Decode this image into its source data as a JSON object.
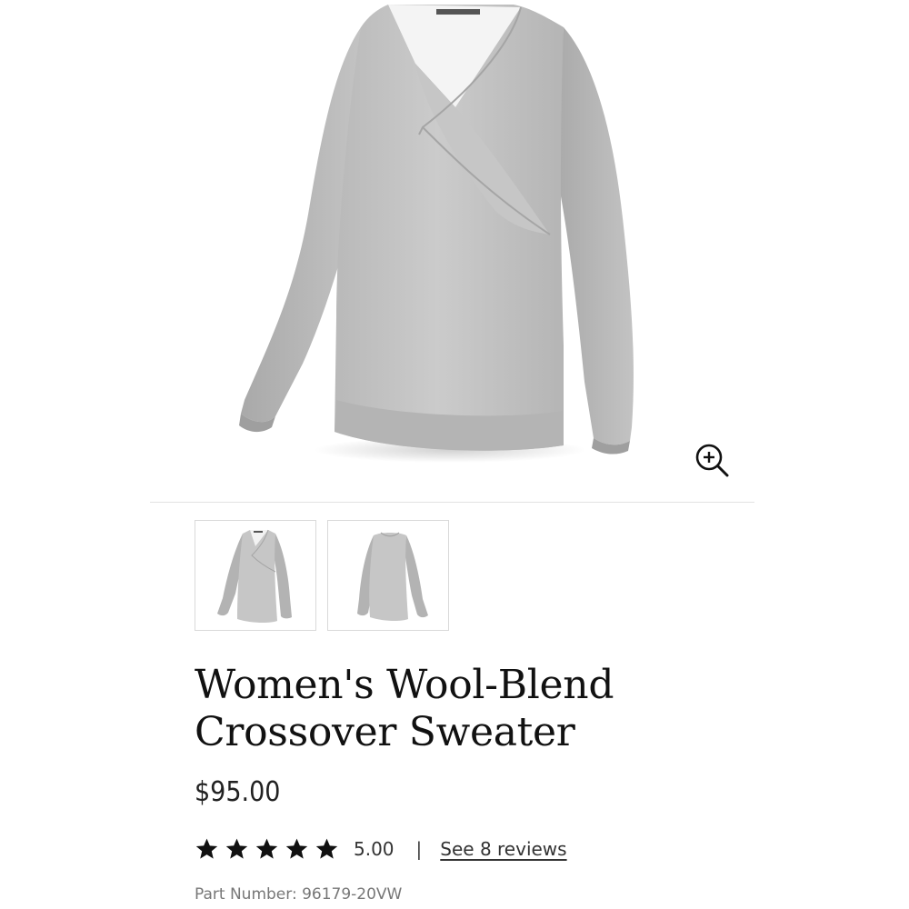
{
  "product": {
    "title_line1": "Women's Wool-Blend",
    "title_line2": "Crossover Sweater",
    "price": "$95.00",
    "rating": {
      "stars": 5,
      "value": "5.00",
      "separator": "|",
      "reviews_link": "See 8 reviews"
    },
    "part_number": "Part Number: 96179-20VW"
  },
  "gallery": {
    "zoom_icon": "zoom-in-icon",
    "thumbnails": [
      "sweater-front",
      "sweater-back"
    ]
  },
  "colors": {
    "sweater_gray": "#c2c2c2",
    "star": "#111111",
    "divider": "#e2e2e2"
  }
}
